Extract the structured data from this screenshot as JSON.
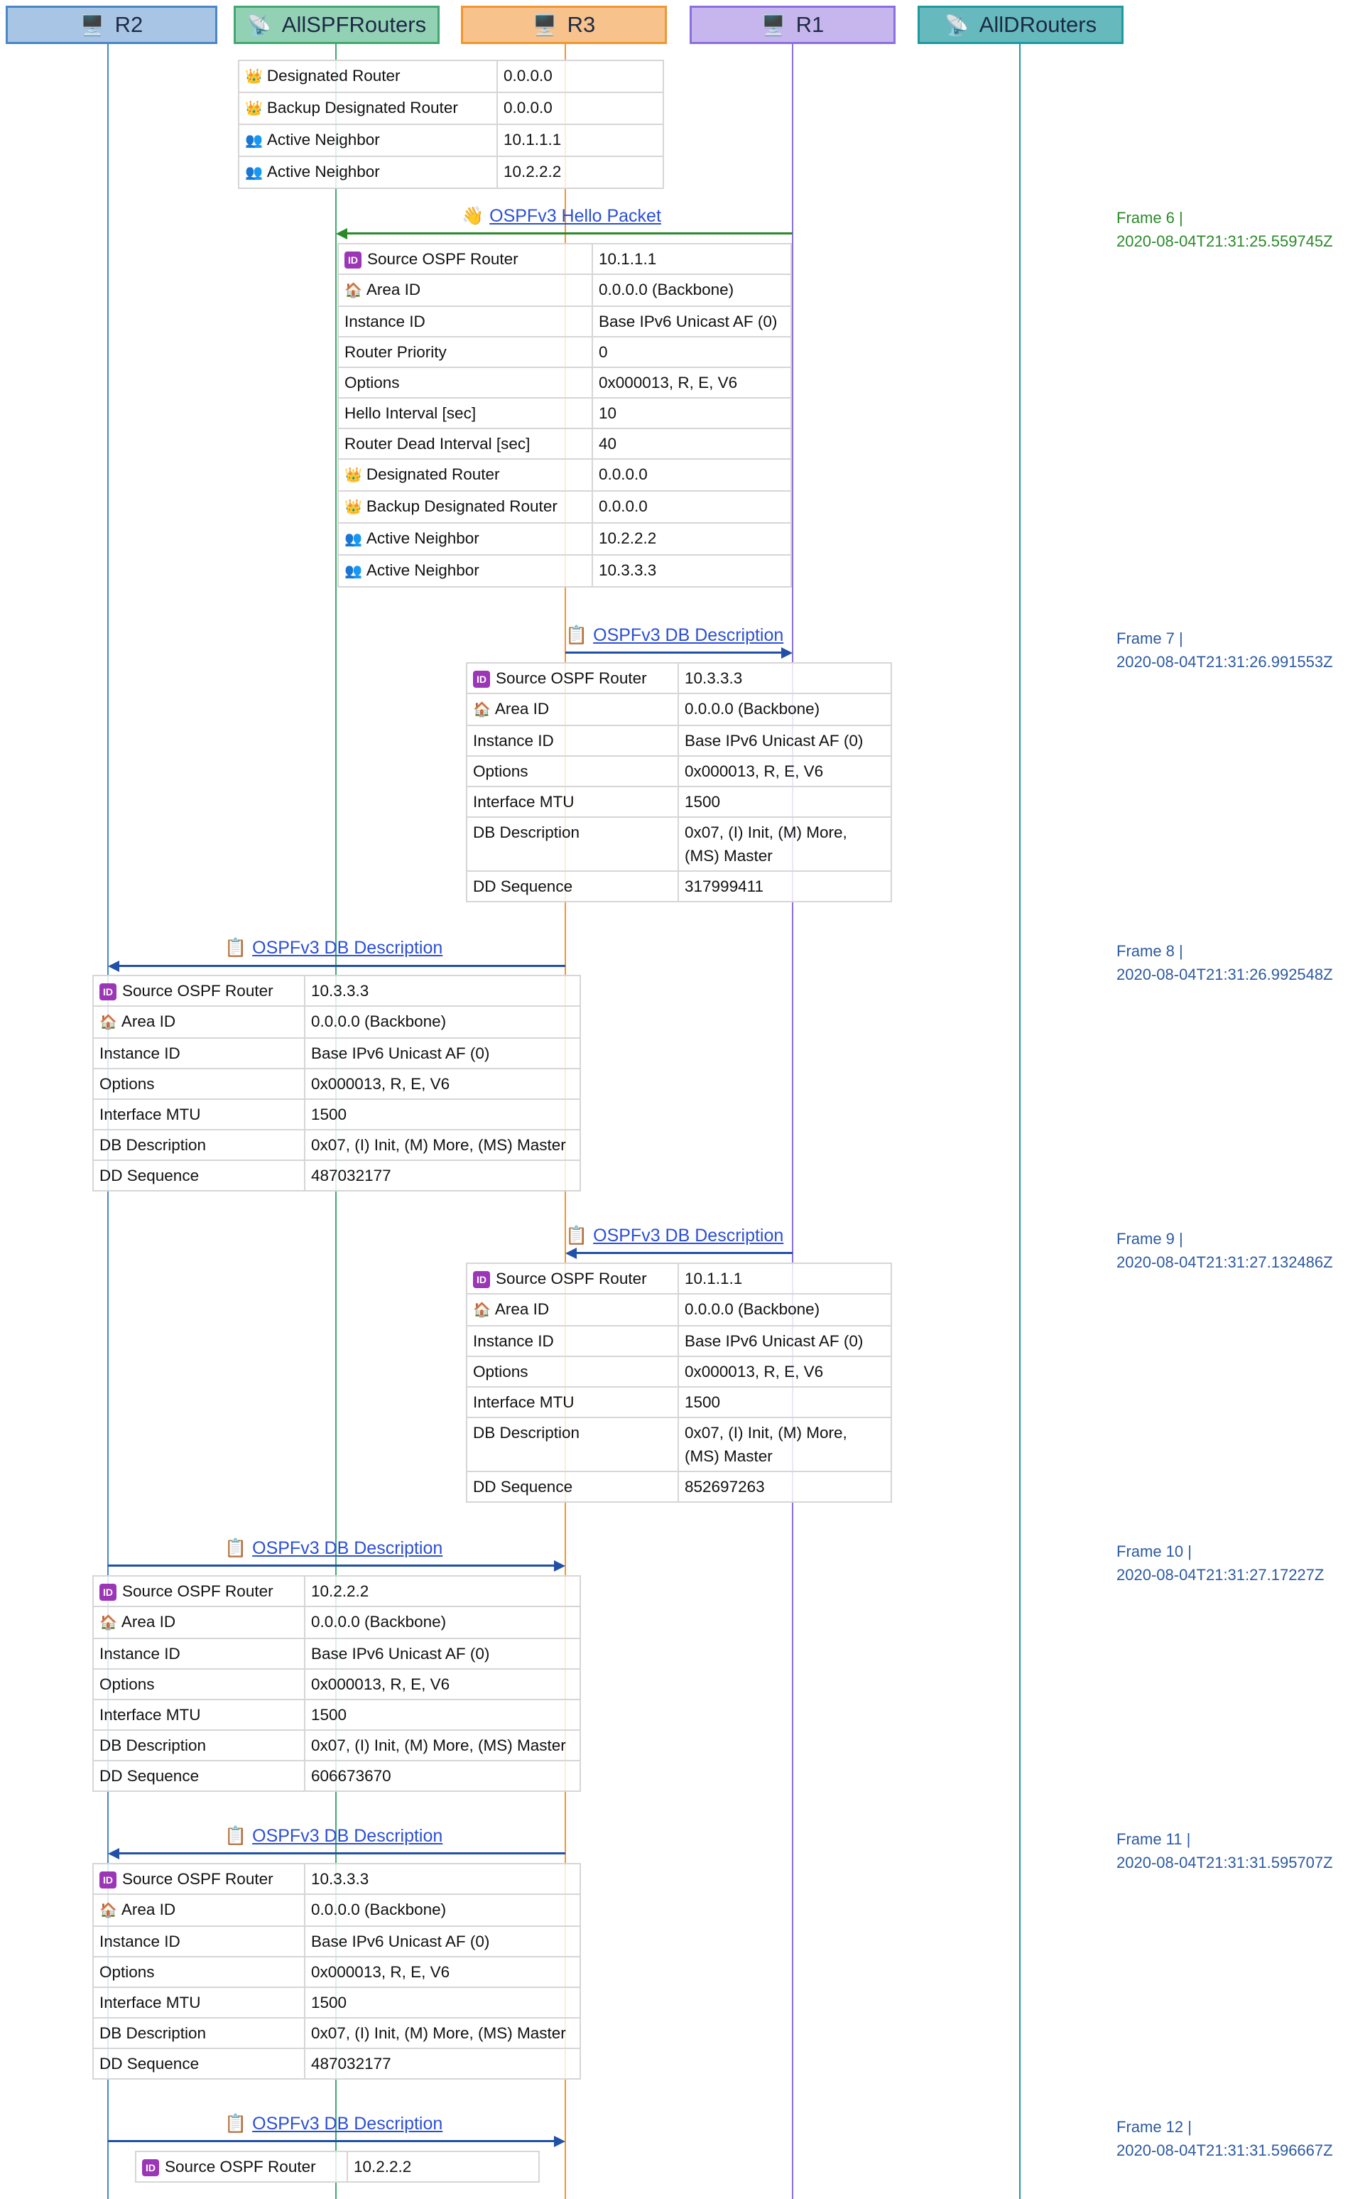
{
  "lanes": [
    {
      "id": "R2",
      "label": "R2",
      "icon": "desktop-computer-icon",
      "glyph": "🖥️",
      "fill": "#a9c5e6",
      "stroke": "#4a86c8",
      "line": "#4a86c8"
    },
    {
      "id": "AllSPFRouters",
      "label": "AllSPFRouters",
      "icon": "satellite-antenna-icon",
      "glyph": "📡",
      "fill": "#93d1b5",
      "stroke": "#40a870",
      "line": "#40a870"
    },
    {
      "id": "R3",
      "label": "R3",
      "icon": "desktop-computer-icon",
      "glyph": "🖥️",
      "fill": "#f8c28d",
      "stroke": "#f2962e",
      "line": "#f2962e"
    },
    {
      "id": "R1",
      "label": "R1",
      "icon": "desktop-computer-icon",
      "glyph": "🖥️",
      "fill": "#c7b6ee",
      "stroke": "#8b6fe0",
      "line": "#8b6fe0"
    },
    {
      "id": "AllDRouters",
      "label": "AllDRouters",
      "icon": "satellite-antenna-icon",
      "glyph": "📡",
      "fill": "#66b9bc",
      "stroke": "#1c9aa0",
      "line": "#1c9aa0"
    }
  ],
  "colors": {
    "hello": "#2a8a2a",
    "dbd": "#2150a8",
    "dbd_text": "#2c4fd6",
    "frame_hello": "#2a8a2a",
    "frame_dbd": "#2c5aa0"
  },
  "top_table": {
    "rows": [
      {
        "icon": "crown-icon",
        "glyph": "👑",
        "key": "Designated Router",
        "value": "0.0.0.0"
      },
      {
        "icon": "crown-icon",
        "glyph": "👑",
        "key": "Backup Designated Router",
        "value": "0.0.0.0"
      },
      {
        "icon": "people-icon",
        "glyph": "👥",
        "key": "Active Neighbor",
        "value": "10.1.1.1"
      },
      {
        "icon": "people-icon",
        "glyph": "👥",
        "key": "Active Neighbor",
        "value": "10.2.2.2"
      }
    ]
  },
  "messages": [
    {
      "label": "OSPFv3 Hello Packet",
      "icon": "waving-hand-icon",
      "glyph": "👋",
      "from": "R1",
      "to": "AllSPFRouters",
      "kind": "hello",
      "frame": "Frame 6 |",
      "timestamp": "2020-08-04T21:31:25.559745Z",
      "rows": [
        {
          "icon": "id-icon",
          "glyph": "ID",
          "key": "Source OSPF Router",
          "value": "10.1.1.1"
        },
        {
          "icon": "house-icon",
          "glyph": "🏠",
          "key": "Area ID",
          "value": "0.0.0.0 (Backbone)"
        },
        {
          "key": "Instance ID",
          "value": "Base IPv6 Unicast AF (0)"
        },
        {
          "key": "Router Priority",
          "value": "0"
        },
        {
          "key": "Options",
          "value": "0x000013, R, E, V6"
        },
        {
          "key": "Hello Interval [sec]",
          "value": "10"
        },
        {
          "key": "Router Dead Interval [sec]",
          "value": "40"
        },
        {
          "icon": "crown-icon",
          "glyph": "👑",
          "key": "Designated Router",
          "value": "0.0.0.0"
        },
        {
          "icon": "crown-icon",
          "glyph": "👑",
          "key": "Backup Designated Router",
          "value": "0.0.0.0"
        },
        {
          "icon": "people-icon",
          "glyph": "👥",
          "key": "Active Neighbor",
          "value": "10.2.2.2"
        },
        {
          "icon": "people-icon",
          "glyph": "👥",
          "key": "Active Neighbor",
          "value": "10.3.3.3"
        }
      ]
    },
    {
      "label": "OSPFv3 DB Description",
      "icon": "clipboard-icon",
      "glyph": "📋",
      "from": "R3",
      "to": "R1",
      "kind": "dbd",
      "frame": "Frame 7 |",
      "timestamp": "2020-08-04T21:31:26.991553Z",
      "rows": [
        {
          "icon": "id-icon",
          "glyph": "ID",
          "key": "Source OSPF Router",
          "value": "10.3.3.3"
        },
        {
          "icon": "house-icon",
          "glyph": "🏠",
          "key": "Area ID",
          "value": "0.0.0.0 (Backbone)"
        },
        {
          "key": "Instance ID",
          "value": "Base IPv6 Unicast AF (0)"
        },
        {
          "key": "Options",
          "value": "0x000013, R, E, V6"
        },
        {
          "key": "Interface MTU",
          "value": "1500"
        },
        {
          "key": "DB Description",
          "value": "0x07, (I) Init, (M) More, (MS) Master"
        },
        {
          "key": "DD Sequence",
          "value": "317999411"
        }
      ]
    },
    {
      "label": "OSPFv3 DB Description",
      "icon": "clipboard-icon",
      "glyph": "📋",
      "from": "R3",
      "to": "R2",
      "kind": "dbd",
      "frame": "Frame 8 |",
      "timestamp": "2020-08-04T21:31:26.992548Z",
      "rows": [
        {
          "icon": "id-icon",
          "glyph": "ID",
          "key": "Source OSPF Router",
          "value": "10.3.3.3"
        },
        {
          "icon": "house-icon",
          "glyph": "🏠",
          "key": "Area ID",
          "value": "0.0.0.0 (Backbone)"
        },
        {
          "key": "Instance ID",
          "value": "Base IPv6 Unicast AF (0)"
        },
        {
          "key": "Options",
          "value": "0x000013, R, E, V6"
        },
        {
          "key": "Interface MTU",
          "value": "1500"
        },
        {
          "key": "DB Description",
          "value": "0x07, (I) Init, (M) More, (MS) Master"
        },
        {
          "key": "DD Sequence",
          "value": "487032177"
        }
      ]
    },
    {
      "label": "OSPFv3 DB Description",
      "icon": "clipboard-icon",
      "glyph": "📋",
      "from": "R1",
      "to": "R3",
      "kind": "dbd",
      "frame": "Frame 9 |",
      "timestamp": "2020-08-04T21:31:27.132486Z",
      "rows": [
        {
          "icon": "id-icon",
          "glyph": "ID",
          "key": "Source OSPF Router",
          "value": "10.1.1.1"
        },
        {
          "icon": "house-icon",
          "glyph": "🏠",
          "key": "Area ID",
          "value": "0.0.0.0 (Backbone)"
        },
        {
          "key": "Instance ID",
          "value": "Base IPv6 Unicast AF (0)"
        },
        {
          "key": "Options",
          "value": "0x000013, R, E, V6"
        },
        {
          "key": "Interface MTU",
          "value": "1500"
        },
        {
          "key": "DB Description",
          "value": "0x07, (I) Init, (M) More, (MS) Master"
        },
        {
          "key": "DD Sequence",
          "value": "852697263"
        }
      ]
    },
    {
      "label": "OSPFv3 DB Description",
      "icon": "clipboard-icon",
      "glyph": "📋",
      "from": "R2",
      "to": "R3",
      "kind": "dbd",
      "frame": "Frame 10 |",
      "timestamp": "2020-08-04T21:31:27.17227Z",
      "rows": [
        {
          "icon": "id-icon",
          "glyph": "ID",
          "key": "Source OSPF Router",
          "value": "10.2.2.2"
        },
        {
          "icon": "house-icon",
          "glyph": "🏠",
          "key": "Area ID",
          "value": "0.0.0.0 (Backbone)"
        },
        {
          "key": "Instance ID",
          "value": "Base IPv6 Unicast AF (0)"
        },
        {
          "key": "Options",
          "value": "0x000013, R, E, V6"
        },
        {
          "key": "Interface MTU",
          "value": "1500"
        },
        {
          "key": "DB Description",
          "value": "0x07, (I) Init, (M) More, (MS) Master"
        },
        {
          "key": "DD Sequence",
          "value": "606673670"
        }
      ]
    },
    {
      "label": "OSPFv3 DB Description",
      "icon": "clipboard-icon",
      "glyph": "📋",
      "from": "R3",
      "to": "R2",
      "kind": "dbd",
      "frame": "Frame 11 |",
      "timestamp": "2020-08-04T21:31:31.595707Z",
      "rows": [
        {
          "icon": "id-icon",
          "glyph": "ID",
          "key": "Source OSPF Router",
          "value": "10.3.3.3"
        },
        {
          "icon": "house-icon",
          "glyph": "🏠",
          "key": "Area ID",
          "value": "0.0.0.0 (Backbone)"
        },
        {
          "key": "Instance ID",
          "value": "Base IPv6 Unicast AF (0)"
        },
        {
          "key": "Options",
          "value": "0x000013, R, E, V6"
        },
        {
          "key": "Interface MTU",
          "value": "1500"
        },
        {
          "key": "DB Description",
          "value": "0x07, (I) Init, (M) More, (MS) Master"
        },
        {
          "key": "DD Sequence",
          "value": "487032177"
        }
      ]
    },
    {
      "label": "OSPFv3 DB Description",
      "icon": "clipboard-icon",
      "glyph": "📋",
      "from": "R2",
      "to": "R3",
      "kind": "dbd",
      "frame": "Frame 12 |",
      "timestamp": "2020-08-04T21:31:31.596667Z",
      "rows": [
        {
          "icon": "id-icon",
          "glyph": "ID",
          "key": "Source OSPF Router",
          "value": "10.2.2.2"
        }
      ]
    }
  ]
}
